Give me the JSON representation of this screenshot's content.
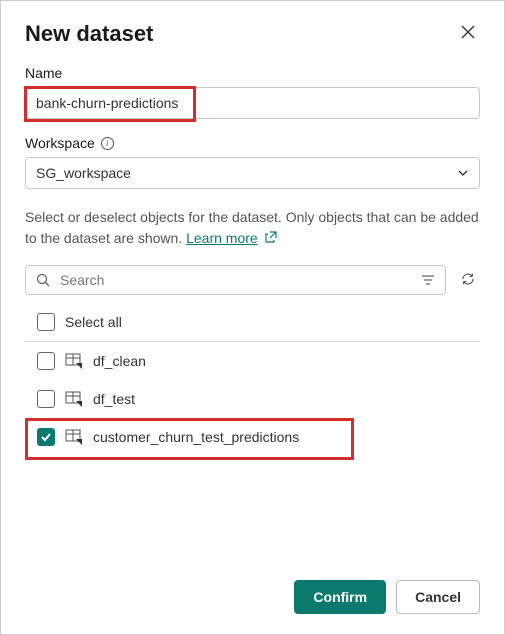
{
  "dialog": {
    "title": "New dataset"
  },
  "fields": {
    "name_label": "Name",
    "name_value": "bank-churn-predictions",
    "workspace_label": "Workspace",
    "workspace_value": "SG_workspace"
  },
  "help": {
    "text_prefix": "Select or deselect objects for the dataset. Only objects that can be added to the dataset are shown. ",
    "learn_more": "Learn more"
  },
  "search": {
    "placeholder": "Search"
  },
  "list": {
    "select_all": "Select all",
    "items": [
      {
        "label": "df_clean",
        "checked": false
      },
      {
        "label": "df_test",
        "checked": false
      },
      {
        "label": "customer_churn_test_predictions",
        "checked": true
      }
    ]
  },
  "footer": {
    "confirm": "Confirm",
    "cancel": "Cancel"
  }
}
